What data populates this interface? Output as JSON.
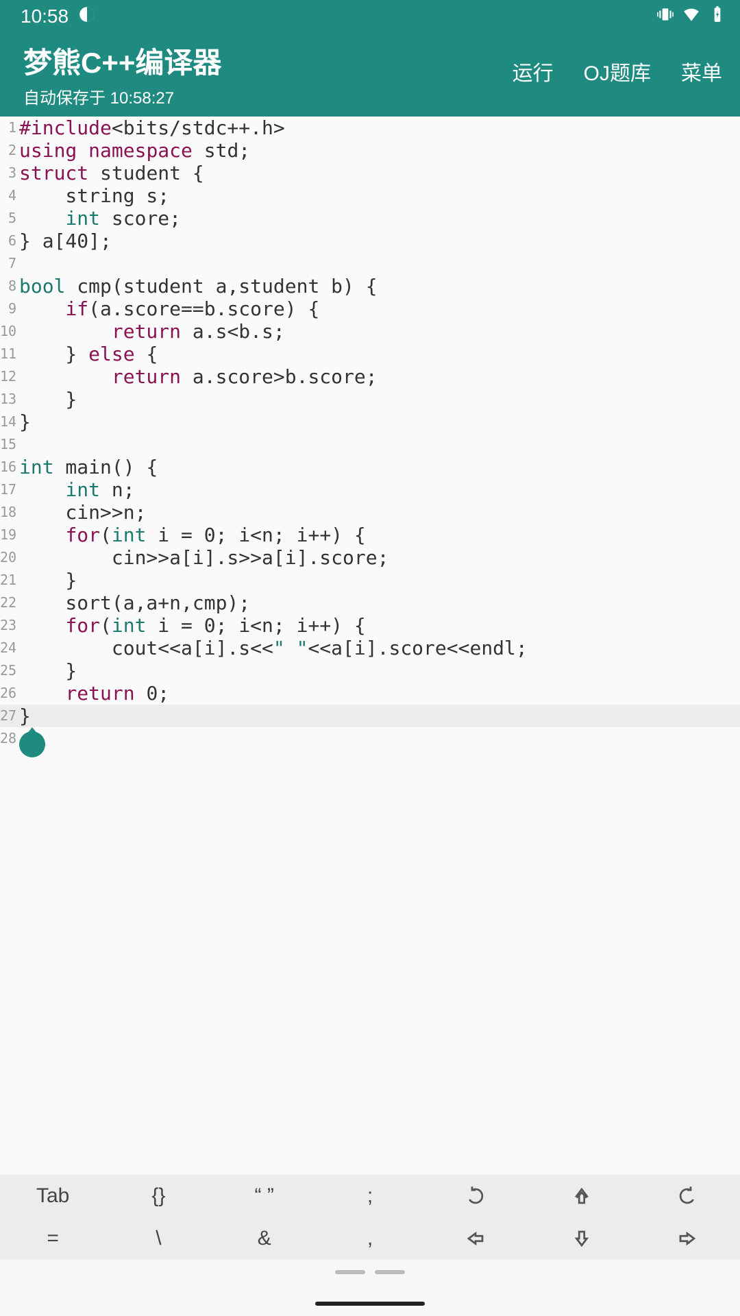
{
  "status": {
    "time": "10:58"
  },
  "header": {
    "title": "梦熊C++编译器",
    "subtitle": "自动保存于 10:58:27",
    "actions": {
      "run": "运行",
      "oj": "OJ题库",
      "menu": "菜单"
    }
  },
  "editor": {
    "current_line": 27,
    "lines": [
      [
        {
          "c": "pp",
          "t": "#include"
        },
        {
          "c": "txt",
          "t": "<bits/stdc++.h>"
        }
      ],
      [
        {
          "c": "kw",
          "t": "using"
        },
        {
          "c": "txt",
          "t": " "
        },
        {
          "c": "kw",
          "t": "namespace"
        },
        {
          "c": "txt",
          "t": " std;"
        }
      ],
      [
        {
          "c": "kw",
          "t": "struct"
        },
        {
          "c": "txt",
          "t": " student {"
        }
      ],
      [
        {
          "c": "txt",
          "t": "    string s;"
        }
      ],
      [
        {
          "c": "txt",
          "t": "    "
        },
        {
          "c": "ty",
          "t": "int"
        },
        {
          "c": "txt",
          "t": " score;"
        }
      ],
      [
        {
          "c": "txt",
          "t": "} a[40];"
        }
      ],
      [
        {
          "c": "txt",
          "t": ""
        }
      ],
      [
        {
          "c": "ty",
          "t": "bool"
        },
        {
          "c": "txt",
          "t": " cmp(student a,student b) {"
        }
      ],
      [
        {
          "c": "txt",
          "t": "    "
        },
        {
          "c": "kw",
          "t": "if"
        },
        {
          "c": "txt",
          "t": "(a.score==b.score) {"
        }
      ],
      [
        {
          "c": "txt",
          "t": "        "
        },
        {
          "c": "kw",
          "t": "return"
        },
        {
          "c": "txt",
          "t": " a.s<b.s;"
        }
      ],
      [
        {
          "c": "txt",
          "t": "    } "
        },
        {
          "c": "kw",
          "t": "else"
        },
        {
          "c": "txt",
          "t": " {"
        }
      ],
      [
        {
          "c": "txt",
          "t": "        "
        },
        {
          "c": "kw",
          "t": "return"
        },
        {
          "c": "txt",
          "t": " a.score>b.score;"
        }
      ],
      [
        {
          "c": "txt",
          "t": "    }"
        }
      ],
      [
        {
          "c": "txt",
          "t": "}"
        }
      ],
      [
        {
          "c": "txt",
          "t": ""
        }
      ],
      [
        {
          "c": "ty",
          "t": "int"
        },
        {
          "c": "txt",
          "t": " main() {"
        }
      ],
      [
        {
          "c": "txt",
          "t": "    "
        },
        {
          "c": "ty",
          "t": "int"
        },
        {
          "c": "txt",
          "t": " n;"
        }
      ],
      [
        {
          "c": "txt",
          "t": "    cin>>n;"
        }
      ],
      [
        {
          "c": "txt",
          "t": "    "
        },
        {
          "c": "kw",
          "t": "for"
        },
        {
          "c": "txt",
          "t": "("
        },
        {
          "c": "ty",
          "t": "int"
        },
        {
          "c": "txt",
          "t": " i = 0; i<n; i++) {"
        }
      ],
      [
        {
          "c": "txt",
          "t": "        cin>>a[i].s>>a[i].score;"
        }
      ],
      [
        {
          "c": "txt",
          "t": "    }"
        }
      ],
      [
        {
          "c": "txt",
          "t": "    sort(a,a+n,cmp);"
        }
      ],
      [
        {
          "c": "txt",
          "t": "    "
        },
        {
          "c": "kw",
          "t": "for"
        },
        {
          "c": "txt",
          "t": "("
        },
        {
          "c": "ty",
          "t": "int"
        },
        {
          "c": "txt",
          "t": " i = 0; i<n; i++) {"
        }
      ],
      [
        {
          "c": "txt",
          "t": "        cout<<a[i].s<<"
        },
        {
          "c": "str",
          "t": "\" \""
        },
        {
          "c": "txt",
          "t": "<<a[i].score<<endl;"
        }
      ],
      [
        {
          "c": "txt",
          "t": "    }"
        }
      ],
      [
        {
          "c": "txt",
          "t": "    "
        },
        {
          "c": "kw",
          "t": "return"
        },
        {
          "c": "txt",
          "t": " 0;"
        }
      ],
      [
        {
          "c": "txt",
          "t": "}"
        }
      ],
      [
        {
          "c": "txt",
          "t": ""
        }
      ]
    ]
  },
  "toolbar": {
    "row1": [
      "Tab",
      "{}",
      "“ ”",
      ";",
      "undo-icon",
      "up-icon",
      "redo-icon"
    ],
    "row2": [
      "=",
      "\\",
      "&",
      ",",
      "left-icon",
      "down-icon",
      "right-icon"
    ]
  }
}
